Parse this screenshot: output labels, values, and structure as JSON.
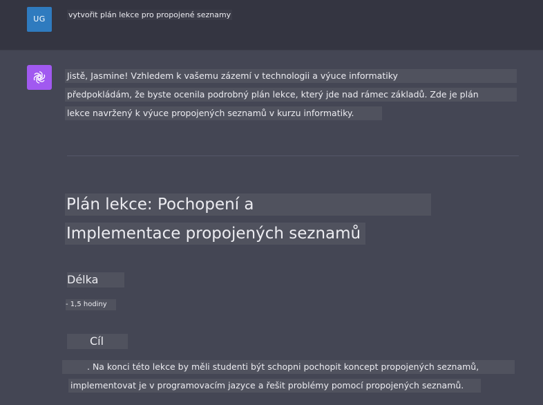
{
  "user": {
    "avatar_initials": "UG",
    "message": "vytvořit plán lekce pro propojené seznamy"
  },
  "assistant": {
    "avatar_icon": "openai-logo-icon",
    "intro_lines": [
      "Jistě, Jasmine! Vzhledem k vašemu zázemí v technologii a výuce informatiky",
      "předpokládám, že byste ocenila podrobný plán lekce, který jde nad rámec základů. Zde je plán",
      "lekce navržený k výuce propojených seznamů v kurzu informatiky."
    ],
    "title_lines": [
      "Plán lekce: Pochopení a",
      "Implementace propojených seznamů"
    ],
    "duration_heading": "Délka",
    "duration_value": "- 1,5 hodiny",
    "goal_heading": "Cíl",
    "goal_lines": [
      ". Na konci této lekce by měli studenti být schopni pochopit koncept propojených seznamů,",
      "implementovat je v programovacím jazyce a řešit problémy pomocí propojených seznamů."
    ]
  },
  "colors": {
    "user_row_bg": "#343541",
    "assistant_row_bg": "#444654",
    "user_avatar": "#2f7bbf",
    "assistant_avatar": "#a159f0"
  }
}
